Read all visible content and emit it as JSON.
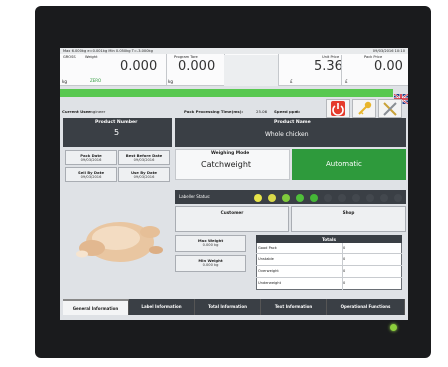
{
  "topbar": {
    "info": "Max 6.000kg  e=0.001kg  Min 0.050kg  T=-3.000kg",
    "datetime": "09/03/2016 10:10"
  },
  "gross": {
    "label": "GROSS",
    "weight_label": "Weight",
    "value": "0.000",
    "unit": "kg",
    "zero": "ZERO"
  },
  "tare": {
    "label": "Program Tare",
    "value": "0.000",
    "unit": "kg"
  },
  "unit_price": {
    "label": "Unit Price",
    "value": "5.36",
    "currency": "£"
  },
  "pack_price": {
    "label": "Pack Price",
    "value": "0.00",
    "currency": "£"
  },
  "status": {
    "user_label": "Current User:",
    "user": "engineer",
    "pack_time_label": "Pack Processing Time(ms):",
    "pack_time": "25.06",
    "speed_label": "Speed ppm:",
    "speed": "0"
  },
  "product_number": {
    "label": "Product Number",
    "value": "5"
  },
  "product_name": {
    "label": "Product Name",
    "value": "Whole chicken"
  },
  "dates": {
    "pack_date_label": "Pack Date",
    "pack_date": "09/03/2016",
    "best_before_label": "Best Before Date",
    "best_before": "09/03/2016",
    "sell_by_label": "Sell By Date",
    "sell_by": "09/03/2016",
    "use_by_label": "Use By Date",
    "use_by": "09/03/2016"
  },
  "weighing_mode": {
    "label": "Weighing Mode",
    "value": "Catchweight",
    "mode": "Automatic"
  },
  "labeller": {
    "label": "Labeller Status:"
  },
  "customer": {
    "label": "Customer"
  },
  "shop": {
    "label": "Shop"
  },
  "max_weight": {
    "label": "Max Weight",
    "value": "0.000 kg"
  },
  "min_weight": {
    "label": "Min Weight",
    "value": "0.000 kg"
  },
  "totals": {
    "title": "Totals",
    "rows": [
      {
        "label": "Good Pack",
        "value": "0"
      },
      {
        "label": "Unstable",
        "value": "0"
      },
      {
        "label": "Overweight",
        "value": "0"
      },
      {
        "label": "Underweight",
        "value": "0"
      }
    ]
  },
  "tabs": [
    {
      "label": "General Information"
    },
    {
      "label": "Label Information"
    },
    {
      "label": "Total Information"
    },
    {
      "label": "Text Information"
    },
    {
      "label": "Operational Functions"
    }
  ],
  "colors": {
    "green": "#2e9a3c",
    "dark_panel": "#3a3f45",
    "power_red": "#e53a2b",
    "accent_green_bar": "#58c850"
  },
  "icons": [
    "uk-flag-icon",
    "power-icon",
    "key-icon",
    "tools-icon"
  ]
}
